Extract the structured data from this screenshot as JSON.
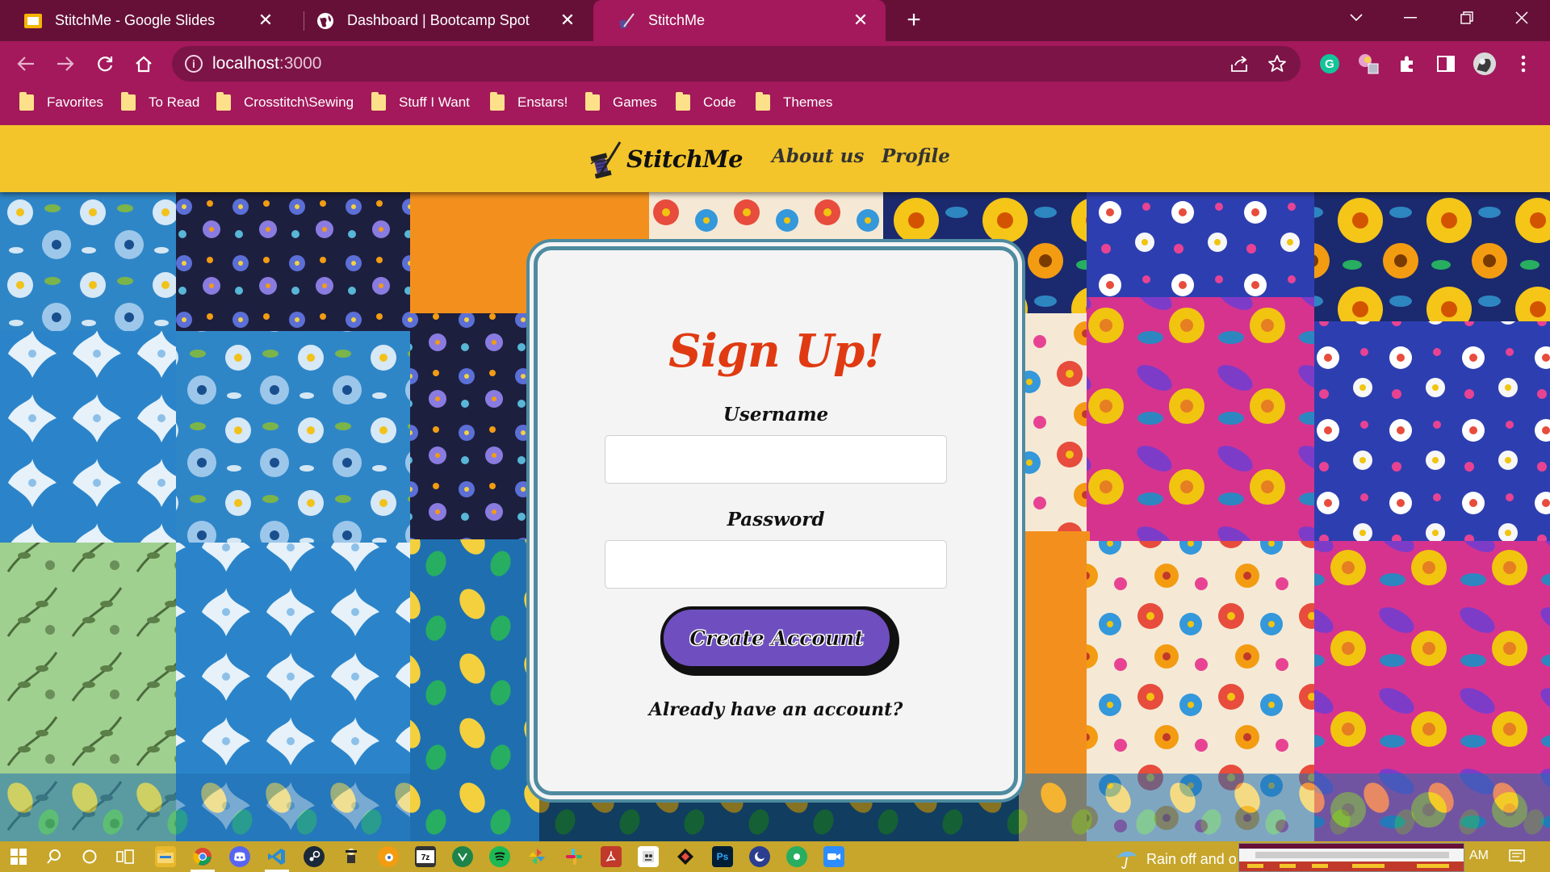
{
  "browser": {
    "tabs": [
      {
        "title": "StitchMe - Google Slides",
        "icon": "google-slides-icon"
      },
      {
        "title": "Dashboard | Bootcamp Spot",
        "icon": "globe-icon"
      },
      {
        "title": "StitchMe",
        "icon": "stitchme-favicon",
        "active": true
      }
    ],
    "url_host": "localhost",
    "url_port": ":3000",
    "bookmarks": [
      "Favorites",
      "To Read",
      "Crosstitch\\Sewing",
      "Stuff I Want",
      "Enstars!",
      "Games",
      "Code",
      "Themes"
    ]
  },
  "site": {
    "brand": "StitchMe",
    "nav": [
      "About us",
      "Profile"
    ]
  },
  "signup": {
    "title": "Sign Up!",
    "username_label": "Username",
    "username_value": "",
    "password_label": "Password",
    "password_value": "",
    "submit_label": "Create Account",
    "login_prompt": "Already have an account?"
  },
  "taskbar": {
    "weather": "Rain off and o",
    "clock": "AM"
  },
  "colors": {
    "tabstrip": "#661038",
    "toolbar": "#a3195b",
    "header": "#f3c52a",
    "title": "#e03a12",
    "button": "#6f4fbf",
    "card_border": "#4e8ba0"
  }
}
